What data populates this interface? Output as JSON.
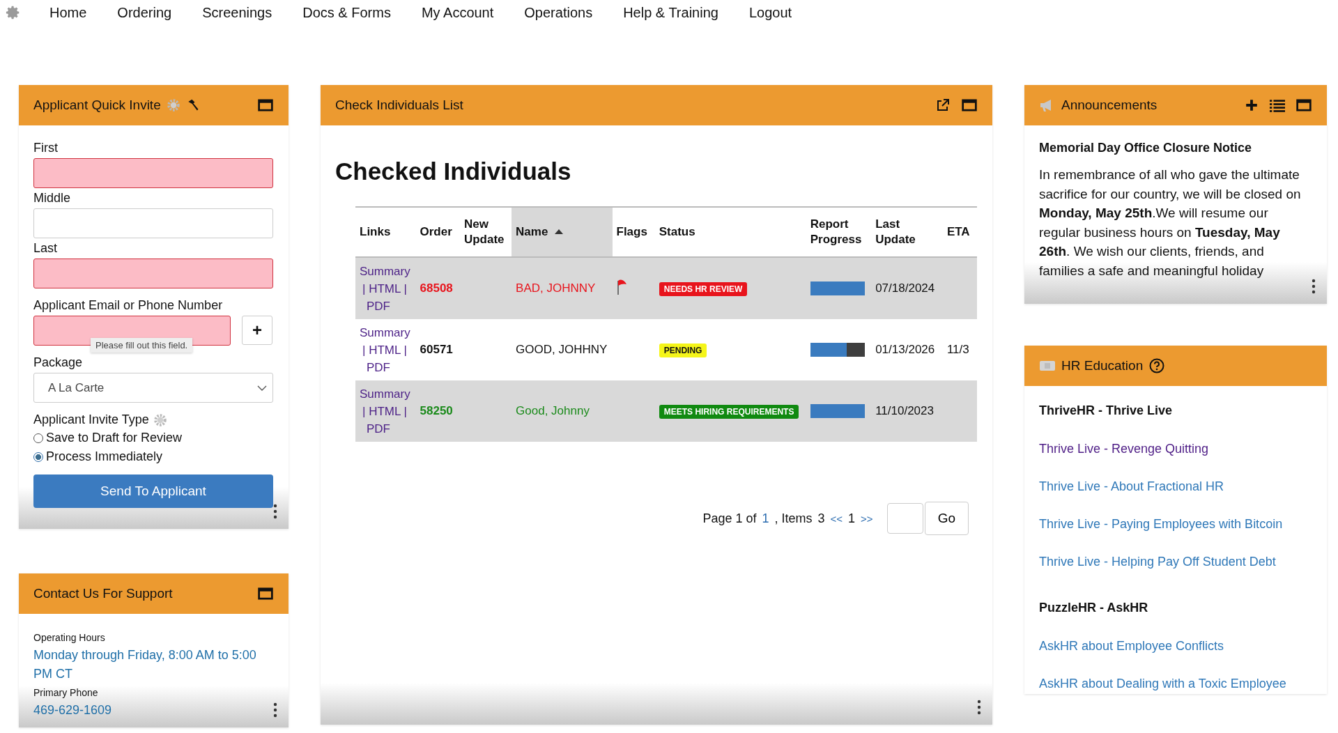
{
  "nav": {
    "items": [
      "Home",
      "Ordering",
      "Screenings",
      "Docs & Forms",
      "My Account",
      "Operations",
      "Help & Training",
      "Logout"
    ]
  },
  "quick_invite": {
    "title": "Applicant Quick Invite",
    "fields": [
      {
        "label": "First",
        "invalid": true
      },
      {
        "label": "Middle",
        "invalid": false
      },
      {
        "label": "Last",
        "invalid": true
      }
    ],
    "contact": {
      "label": "Applicant Email or Phone Number",
      "invalid": true,
      "tooltip": "Please fill out this field.",
      "add": "+"
    },
    "package": {
      "label": "Package",
      "value": "A La Carte"
    },
    "invite_type": {
      "label": "Applicant Invite Type",
      "options": [
        {
          "label": "Save to Draft for Review",
          "selected": false
        },
        {
          "label": "Process Immediately",
          "selected": true
        }
      ]
    },
    "button": "Send To Applicant"
  },
  "support": {
    "title": "Contact Us For Support",
    "sections": [
      {
        "label": "Operating Hours",
        "value": "Monday through Friday, 8:00 AM to 5:00 PM CT"
      },
      {
        "label": "Primary Phone",
        "value": "469-629-1609"
      }
    ]
  },
  "checks": {
    "title": "Check Individuals List",
    "heading": "Checked Individuals",
    "columns": [
      {
        "label": "Links",
        "sorted": false
      },
      {
        "label": "Order",
        "sorted": false
      },
      {
        "label": "New Update",
        "sorted": false
      },
      {
        "label": "Name",
        "sorted": true
      },
      {
        "label": "Flags",
        "sorted": false
      },
      {
        "label": "Status",
        "sorted": false
      },
      {
        "label": "Report Progress",
        "sorted": false
      },
      {
        "label": "Last Update",
        "sorted": false
      },
      {
        "label": "ETA",
        "sorted": false
      }
    ],
    "rows": [
      {
        "links": [
          "Summary",
          "| HTML |",
          "PDF"
        ],
        "order": "68508",
        "name": "BAD, JOHNNY",
        "color": "#e8141c",
        "flagged": true,
        "status": {
          "label": "NEEDS HR REVIEW",
          "color": "#e8141c"
        },
        "level": 1,
        "last_update": "07/18/2024"
      },
      {
        "links": [
          "Summary",
          "| HTML |",
          "PDF"
        ],
        "order": "60571",
        "name": "GOOD, JOHHNY",
        "color": "#111111",
        "flagged": false,
        "status": {
          "label": "PENDING",
          "color": "#f5f51a"
        },
        "level": 0.67,
        "last_update": "01/13/2026",
        "eta": "11/3"
      },
      {
        "links": [
          "Summary",
          "| HTML |",
          "PDF"
        ],
        "order": "58250",
        "name": "Good, Johnny",
        "color": "#1a8a1a",
        "flagged": false,
        "status": {
          "label": "MEETS HIRING REQUIREMENTS",
          "color": "#108a10"
        },
        "level": 1,
        "last_update": "11/10/2023"
      }
    ],
    "pager": {
      "page_label": "Page 1 of",
      "pages": "1",
      "items_label": ", Items",
      "items": "3",
      "prev": "<<",
      "current": "1",
      "next": ">>",
      "go": "Go"
    }
  },
  "announcements": {
    "title": "Announcements",
    "heading": "Memorial Day Office Closure Notice",
    "body": "In remembrance of all who gave the ultimate sacrifice for our country, we will be closed on **Monday, May 25th**.We will resume our regular business hours on **Tuesday, May 26th**. We wish our clients, friends, and families a safe and meaningful holiday"
  },
  "education": {
    "title": "HR Education",
    "groups": [
      {
        "heading": "ThriveHR - Thrive Live",
        "links": [
          {
            "label": "Thrive Live - Revenge Quitting",
            "visited": true
          },
          {
            "label": "Thrive Live - About Fractional HR",
            "visited": false
          },
          {
            "label": "Thrive Live - Paying Employees with Bitcoin",
            "visited": false
          },
          {
            "label": "Thrive Live - Helping Pay Off Student Debt",
            "visited": false
          }
        ]
      },
      {
        "heading": "PuzzleHR - AskHR",
        "links": [
          {
            "label": "AskHR about Employee Conflicts",
            "visited": false
          },
          {
            "label": "AskHR about Dealing with a Toxic Employee",
            "visited": false
          }
        ]
      }
    ]
  }
}
